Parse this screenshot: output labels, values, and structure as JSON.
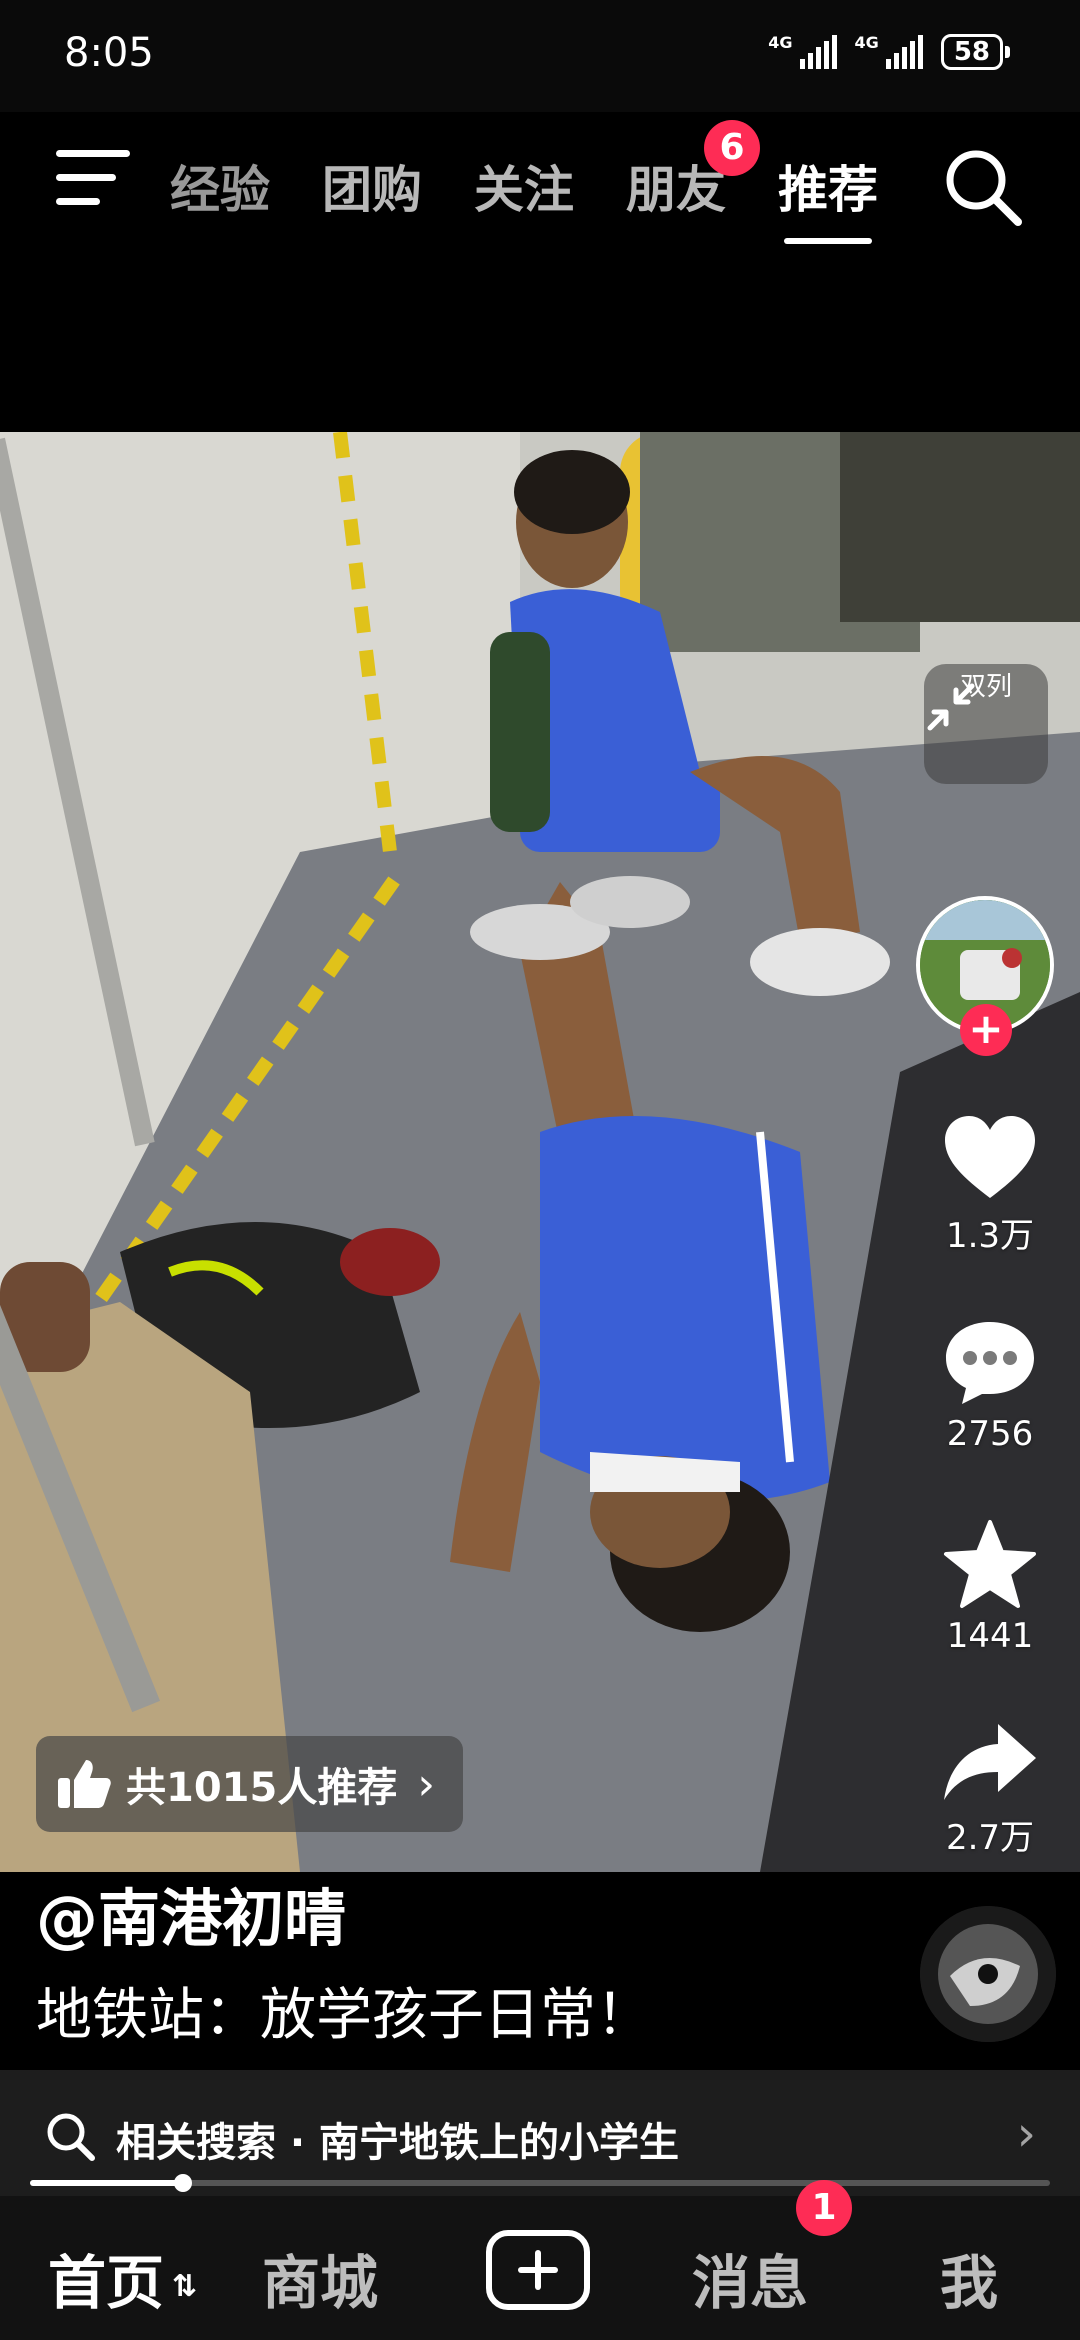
{
  "status_bar": {
    "time": "8:05",
    "network1": "4G",
    "network2": "4G",
    "battery": "58"
  },
  "top_nav": {
    "tabs": [
      {
        "label": "经验"
      },
      {
        "label": "团购"
      },
      {
        "label": "关注"
      },
      {
        "label": "朋友",
        "badge": "6"
      },
      {
        "label": "推荐",
        "active": true
      }
    ]
  },
  "video": {
    "dual_column_label": "双列",
    "like_count": "1.3万",
    "comment_count": "2756",
    "favorite_count": "1441",
    "share_count": "2.7万",
    "recommend_text": "共1015人推荐",
    "author": "@南港初晴",
    "caption": "地铁站：放学孩子日常！"
  },
  "related_search": {
    "text": "相关搜索 · 南宁地铁上的小学生"
  },
  "playback": {
    "progress_percent": 15
  },
  "bottom_nav": {
    "home": "首页",
    "mall": "商城",
    "messages": "消息",
    "messages_badge": "1",
    "me": "我"
  },
  "colors": {
    "accent": "#fe2c55",
    "background": "#000000",
    "jersey": "#3a5fd6"
  },
  "icons": [
    "menu-icon",
    "search-icon",
    "collapse-icon",
    "heart-icon",
    "comment-icon",
    "star-icon",
    "share-icon",
    "thumbs-up-icon",
    "chevron-right-icon",
    "plus-icon"
  ]
}
